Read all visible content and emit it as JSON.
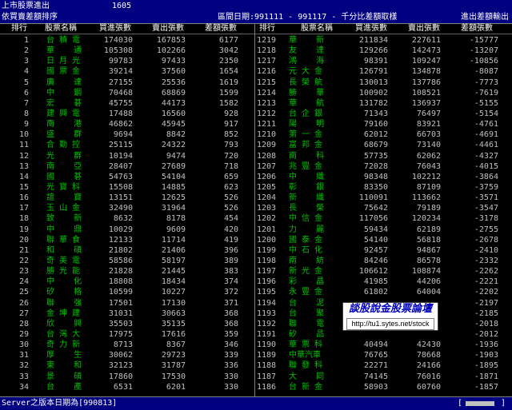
{
  "title_bar": {
    "title": "上市股票進出",
    "number": "1605"
  },
  "info_bar": {
    "left": "依買賣差額排序",
    "center": "區間日期:991111 - 991117 - 千分比差額取樣",
    "right": "進出差額輸出"
  },
  "headers": {
    "rank": "排行",
    "name": "股票名稱",
    "buy": "買進張數",
    "sell": "賣出張數",
    "diff": "差額張數"
  },
  "left_rows": [
    {
      "rank": "1",
      "name": "台 積 電",
      "buy": "174030",
      "sell": "167853",
      "diff": "6177"
    },
    {
      "rank": "2",
      "name": "華    通",
      "buy": "105308",
      "sell": "102266",
      "diff": "3042"
    },
    {
      "rank": "3",
      "name": "日 月 光",
      "buy": "99783",
      "sell": "97433",
      "diff": "2350"
    },
    {
      "rank": "4",
      "name": "國 票 金",
      "buy": "39214",
      "sell": "37560",
      "diff": "1654"
    },
    {
      "rank": "5",
      "name": "廣    達",
      "buy": "27155",
      "sell": "25536",
      "diff": "1619"
    },
    {
      "rank": "6",
      "name": "中    鋼",
      "buy": "70468",
      "sell": "68869",
      "diff": "1599"
    },
    {
      "rank": "7",
      "name": "宏    碁",
      "buy": "45755",
      "sell": "44173",
      "diff": "1582"
    },
    {
      "rank": "8",
      "name": "建 興 電",
      "buy": "17488",
      "sell": "16560",
      "diff": "928"
    },
    {
      "rank": "9",
      "name": "南    港",
      "buy": "46862",
      "sell": "45945",
      "diff": "917"
    },
    {
      "rank": "10",
      "name": "盛    群",
      "buy": "9694",
      "sell": "8842",
      "diff": "852"
    },
    {
      "rank": "11",
      "name": "合 勤 控",
      "buy": "25115",
      "sell": "24322",
      "diff": "793"
    },
    {
      "rank": "12",
      "name": "光    群",
      "buy": "10194",
      "sell": "9474",
      "diff": "720"
    },
    {
      "rank": "13",
      "name": "南    亞",
      "buy": "28407",
      "sell": "27689",
      "diff": "718"
    },
    {
      "rank": "14",
      "name": "國    碁",
      "buy": "54763",
      "sell": "54104",
      "diff": "659"
    },
    {
      "rank": "15",
      "name": "光 寶 科",
      "buy": "15508",
      "sell": "14885",
      "diff": "623"
    },
    {
      "rank": "16",
      "name": "誼    寶",
      "buy": "13151",
      "sell": "12625",
      "diff": "526"
    },
    {
      "rank": "17",
      "name": "玉 山 金",
      "buy": "32490",
      "sell": "31964",
      "diff": "526"
    },
    {
      "rank": "18",
      "name": "致    新",
      "buy": "8632",
      "sell": "8178",
      "diff": "454"
    },
    {
      "rank": "19",
      "name": "中    鼎",
      "buy": "10029",
      "sell": "9609",
      "diff": "420"
    },
    {
      "rank": "20",
      "name": "聯 華 食",
      "buy": "12133",
      "sell": "11714",
      "diff": "419"
    },
    {
      "rank": "21",
      "name": "和    碩",
      "buy": "21802",
      "sell": "21406",
      "diff": "396"
    },
    {
      "rank": "22",
      "name": "奇 美 電",
      "buy": "58586",
      "sell": "58197",
      "diff": "389"
    },
    {
      "rank": "23",
      "name": "勝 光 能",
      "buy": "21828",
      "sell": "21445",
      "diff": "383"
    },
    {
      "rank": "24",
      "name": "中    化",
      "buy": "18808",
      "sell": "18434",
      "diff": "374"
    },
    {
      "rank": "25",
      "name": "矽    格",
      "buy": "10599",
      "sell": "10227",
      "diff": "372"
    },
    {
      "rank": "26",
      "name": "聯    強",
      "buy": "17501",
      "sell": "17130",
      "diff": "371"
    },
    {
      "rank": "27",
      "name": "金 坤 建",
      "buy": "31031",
      "sell": "30663",
      "diff": "368"
    },
    {
      "rank": "28",
      "name": "欣    興",
      "buy": "35503",
      "sell": "35135",
      "diff": "368"
    },
    {
      "rank": "29",
      "name": "台 灣 大",
      "buy": "17975",
      "sell": "17616",
      "diff": "359"
    },
    {
      "rank": "30",
      "name": "奇 力 新",
      "buy": "8713",
      "sell": "8367",
      "diff": "346"
    },
    {
      "rank": "31",
      "name": "厚    生",
      "buy": "30062",
      "sell": "29723",
      "diff": "339"
    },
    {
      "rank": "32",
      "name": "東    和",
      "buy": "32123",
      "sell": "31787",
      "diff": "336"
    },
    {
      "rank": "33",
      "name": "景    碩",
      "buy": "17860",
      "sell": "17530",
      "diff": "330"
    },
    {
      "rank": "34",
      "name": "台    產",
      "buy": "6531",
      "sell": "6201",
      "diff": "330"
    }
  ],
  "right_rows": [
    {
      "rank": "1219",
      "name": "華    新",
      "buy": "211834",
      "sell": "227611",
      "diff": "-15777"
    },
    {
      "rank": "1218",
      "name": "友    達",
      "buy": "129266",
      "sell": "142473",
      "diff": "-13207"
    },
    {
      "rank": "1217",
      "name": "鴻    海",
      "buy": "98391",
      "sell": "109247",
      "diff": "-10856"
    },
    {
      "rank": "1216",
      "name": "元 大 金",
      "buy": "126791",
      "sell": "134878",
      "diff": "-8087"
    },
    {
      "rank": "1215",
      "name": "長 榮 航",
      "buy": "130013",
      "sell": "137786",
      "diff": "-7773"
    },
    {
      "rank": "1214",
      "name": "勝    華",
      "buy": "100902",
      "sell": "108521",
      "diff": "-7619"
    },
    {
      "rank": "1213",
      "name": "華    航",
      "buy": "131782",
      "sell": "136937",
      "diff": "-5155"
    },
    {
      "rank": "1212",
      "name": "台 企 銀",
      "buy": "71343",
      "sell": "76497",
      "diff": "-5154"
    },
    {
      "rank": "1211",
      "name": "陽    明",
      "buy": "79160",
      "sell": "83921",
      "diff": "-4761"
    },
    {
      "rank": "1210",
      "name": "第 一 金",
      "buy": "62012",
      "sell": "66703",
      "diff": "-4691"
    },
    {
      "rank": "1209",
      "name": "富 邦 金",
      "buy": "68679",
      "sell": "73140",
      "diff": "-4461"
    },
    {
      "rank": "1208",
      "name": "南    科",
      "buy": "57735",
      "sell": "62062",
      "diff": "-4327"
    },
    {
      "rank": "1207",
      "name": "兆 豐 金",
      "buy": "72028",
      "sell": "76043",
      "diff": "-4015"
    },
    {
      "rank": "1206",
      "name": "中    纖",
      "buy": "98348",
      "sell": "102212",
      "diff": "-3864"
    },
    {
      "rank": "1205",
      "name": "彰    銀",
      "buy": "83350",
      "sell": "87109",
      "diff": "-3759"
    },
    {
      "rank": "1204",
      "name": "新    纖",
      "buy": "110091",
      "sell": "113662",
      "diff": "-3571"
    },
    {
      "rank": "1203",
      "name": "長    榮",
      "buy": "75642",
      "sell": "79189",
      "diff": "-3547"
    },
    {
      "rank": "1202",
      "name": "中 信 金",
      "buy": "117056",
      "sell": "120234",
      "diff": "-3178"
    },
    {
      "rank": "1201",
      "name": "力    麗",
      "buy": "59434",
      "sell": "62189",
      "diff": "-2755"
    },
    {
      "rank": "1200",
      "name": "國 泰 金",
      "buy": "54140",
      "sell": "56818",
      "diff": "-2678"
    },
    {
      "rank": "1199",
      "name": "中 石 化",
      "buy": "92457",
      "sell": "94867",
      "diff": "-2410"
    },
    {
      "rank": "1198",
      "name": "南    紡",
      "buy": "84246",
      "sell": "86578",
      "diff": "-2332"
    },
    {
      "rank": "1197",
      "name": "新 光 金",
      "buy": "106612",
      "sell": "108874",
      "diff": "-2262"
    },
    {
      "rank": "1196",
      "name": "彩    晶",
      "buy": "41985",
      "sell": "44206",
      "diff": "-2221"
    },
    {
      "rank": "1195",
      "name": "永 豐 金",
      "buy": "61802",
      "sell": "64004",
      "diff": "-2202"
    },
    {
      "rank": "1194",
      "name": "台    泥",
      "buy": "",
      "sell": "",
      "diff": "-2197"
    },
    {
      "rank": "1193",
      "name": "台    聚",
      "buy": "",
      "sell": "",
      "diff": "-2185"
    },
    {
      "rank": "1192",
      "name": "聯    電",
      "buy": "",
      "sell": "",
      "diff": "-2018"
    },
    {
      "rank": "1191",
      "name": "矽    品",
      "buy": "",
      "sell": "",
      "diff": "-2012"
    },
    {
      "rank": "1190",
      "name": "華 票 科",
      "buy": "40494",
      "sell": "42430",
      "diff": "-1936"
    },
    {
      "rank": "1189",
      "name": "中華汽車",
      "buy": "76765",
      "sell": "78668",
      "diff": "-1903"
    },
    {
      "rank": "1188",
      "name": "聯 發 科",
      "buy": "22271",
      "sell": "24166",
      "diff": "-1895"
    },
    {
      "rank": "1187",
      "name": "大    同",
      "buy": "74145",
      "sell": "76016",
      "diff": "-1871"
    },
    {
      "rank": "1186",
      "name": "台 新 金",
      "buy": "58903",
      "sell": "60760",
      "diff": "-1857"
    }
  ],
  "stamp": {
    "line1": "談股說金股票論壇",
    "line2": "http://tu1.sytes.net/stock"
  },
  "footer": {
    "text": "Server之版本日期為[990813]",
    "bracket_open": "[",
    "bracket_close": "]"
  }
}
